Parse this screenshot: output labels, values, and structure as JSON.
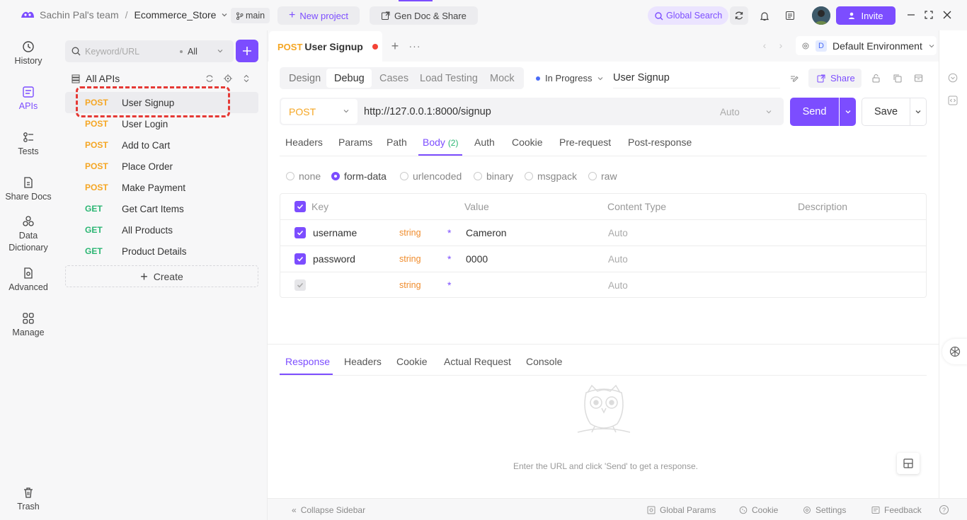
{
  "topbar": {
    "team": "Sachin Pal's team",
    "separator": "/",
    "project": "Ecommerce_Store",
    "branch": "main",
    "new_project": "New project",
    "gen_doc": "Gen Doc & Share",
    "global_search": "Global Search",
    "invite": "Invite"
  },
  "nav": {
    "history": "History",
    "apis": "APIs",
    "tests": "Tests",
    "share_docs": "Share Docs",
    "data_dictionary_1": "Data",
    "data_dictionary_2": "Dictionary",
    "advanced": "Advanced",
    "manage": "Manage",
    "trash": "Trash"
  },
  "api_panel": {
    "search_placeholder": "Keyword/URL",
    "filter": "All",
    "all_apis": "All APIs",
    "create": "Create",
    "items": [
      {
        "method": "POST",
        "name": "User Signup"
      },
      {
        "method": "POST",
        "name": "User Login"
      },
      {
        "method": "POST",
        "name": "Add to Cart"
      },
      {
        "method": "POST",
        "name": "Place Order"
      },
      {
        "method": "POST",
        "name": "Make Payment"
      },
      {
        "method": "GET",
        "name": "Get Cart Items"
      },
      {
        "method": "GET",
        "name": "All Products"
      },
      {
        "method": "GET",
        "name": "Product Details"
      }
    ]
  },
  "tabbar": {
    "tab_method": "POST",
    "tab_name": "User Signup",
    "env_letter": "D",
    "environment": "Default Environment"
  },
  "subtabs": {
    "design": "Design",
    "debug": "Debug",
    "cases": "Cases",
    "load_testing": "Load Testing",
    "mock": "Mock",
    "status": "In Progress",
    "api_name": "User Signup",
    "share": "Share"
  },
  "request": {
    "method": "POST",
    "url": "http://127.0.0.1:8000/signup",
    "auto": "Auto",
    "send": "Send",
    "save": "Save"
  },
  "param_tabs": {
    "headers": "Headers",
    "params": "Params",
    "path": "Path",
    "body": "Body",
    "body_count": "(2)",
    "auth": "Auth",
    "cookie": "Cookie",
    "pre_request": "Pre-request",
    "post_response": "Post-response"
  },
  "body_types": {
    "none": "none",
    "form_data": "form-data",
    "urlencoded": "urlencoded",
    "binary": "binary",
    "msgpack": "msgpack",
    "raw": "raw"
  },
  "table": {
    "headers": {
      "key": "Key",
      "value": "Value",
      "content_type": "Content Type",
      "description": "Description"
    },
    "rows": [
      {
        "key": "username",
        "type": "string",
        "required": "*",
        "value": "Cameron",
        "content_type": "Auto"
      },
      {
        "key": "password",
        "type": "string",
        "required": "*",
        "value": "0000",
        "content_type": "Auto"
      },
      {
        "key": "",
        "type": "string",
        "required": "*",
        "value": "",
        "content_type": "Auto"
      }
    ]
  },
  "response": {
    "tabs": {
      "response": "Response",
      "headers": "Headers",
      "cookie": "Cookie",
      "actual_request": "Actual Request",
      "console": "Console"
    },
    "empty_message": "Enter the URL and click 'Send' to get a response."
  },
  "statusbar": {
    "collapse": "Collapse Sidebar",
    "global_params": "Global Params",
    "cookie": "Cookie",
    "settings": "Settings",
    "feedback": "Feedback"
  },
  "colors": {
    "accent": "#7c4dff",
    "post": "#f5a623",
    "get": "#2bb673",
    "highlight": "#e53935"
  }
}
